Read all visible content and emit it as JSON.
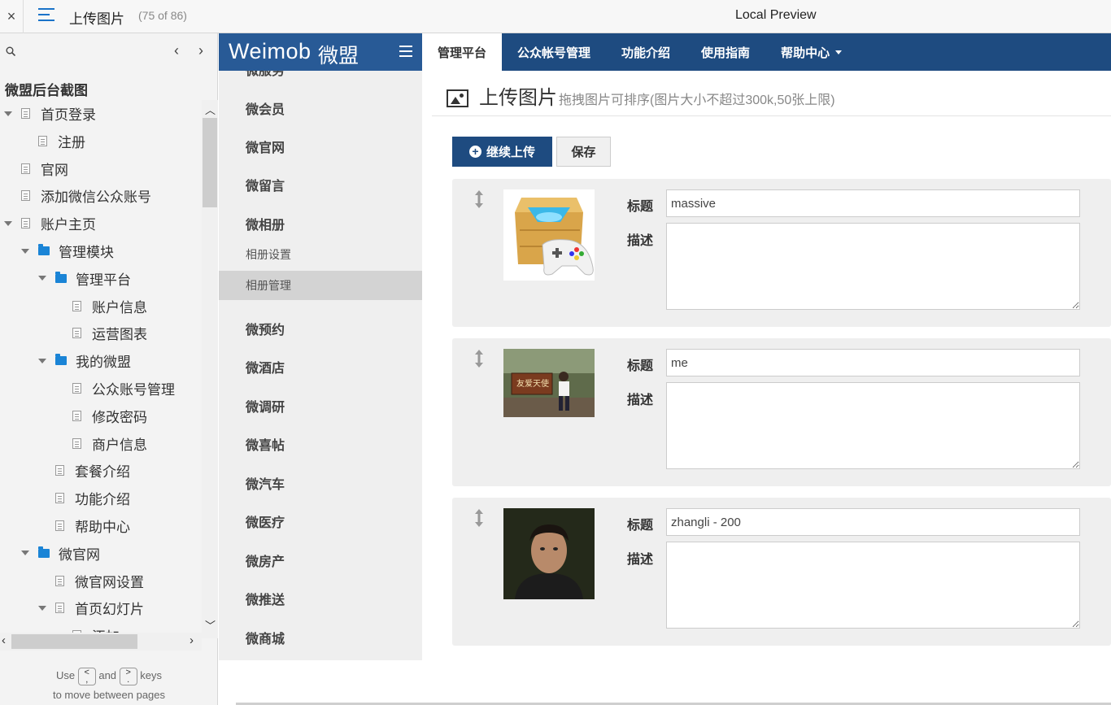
{
  "topbar": {
    "close": "×",
    "title": "上传图片",
    "count": "(75 of 86)",
    "preview": "Local Preview"
  },
  "tree": {
    "heading": "微盟后台截图",
    "prev": "‹",
    "next": "›",
    "items": [
      {
        "label": "首页登录",
        "type": "page",
        "expand": true
      },
      {
        "label": "注册",
        "type": "page",
        "expand": false
      },
      {
        "label": "官网",
        "type": "page",
        "expand": false
      },
      {
        "label": "添加微信公众账号",
        "type": "page",
        "expand": false
      },
      {
        "label": "账户主页",
        "type": "page",
        "expand": true
      },
      {
        "label": "管理模块",
        "type": "folder",
        "expand": true
      },
      {
        "label": "管理平台",
        "type": "folder",
        "expand": true
      },
      {
        "label": "账户信息",
        "type": "page",
        "expand": false
      },
      {
        "label": "运营图表",
        "type": "page",
        "expand": false
      },
      {
        "label": "我的微盟",
        "type": "folder",
        "expand": true
      },
      {
        "label": "公众账号管理",
        "type": "page",
        "expand": false
      },
      {
        "label": "修改密码",
        "type": "page",
        "expand": false
      },
      {
        "label": "商户信息",
        "type": "page",
        "expand": false
      },
      {
        "label": "套餐介绍",
        "type": "page",
        "expand": false
      },
      {
        "label": "功能介绍",
        "type": "page",
        "expand": false
      },
      {
        "label": "帮助中心",
        "type": "page",
        "expand": false
      },
      {
        "label": "微官网",
        "type": "folder",
        "expand": true
      },
      {
        "label": "微官网设置",
        "type": "page",
        "expand": false
      },
      {
        "label": "首页幻灯片",
        "type": "page",
        "expand": true
      },
      {
        "label": "添加",
        "type": "page",
        "expand": false
      }
    ],
    "keys_use": "Use",
    "keys_and": "and",
    "keys_keys": "keys",
    "keys_line2": "to move between pages",
    "key_prev": "<\n,",
    "key_next": ">\n."
  },
  "app": {
    "logo": "Weimob",
    "logo_cn": "微盟",
    "nav": [
      "管理平台",
      "公众帐号管理",
      "功能介绍",
      "使用指南",
      "帮助中心"
    ],
    "menu": [
      {
        "label": "微服务",
        "sub": false,
        "sel": false
      },
      {
        "label": "微会员",
        "sub": false,
        "sel": false
      },
      {
        "label": "微官网",
        "sub": false,
        "sel": false
      },
      {
        "label": "微留言",
        "sub": false,
        "sel": false
      },
      {
        "label": "微相册",
        "sub": false,
        "sel": false
      },
      {
        "label": "相册设置",
        "sub": true,
        "sel": false
      },
      {
        "label": "相册管理",
        "sub": true,
        "sel": true
      },
      {
        "label": "微预约",
        "sub": false,
        "sel": false
      },
      {
        "label": "微酒店",
        "sub": false,
        "sel": false
      },
      {
        "label": "微调研",
        "sub": false,
        "sel": false
      },
      {
        "label": "微喜帖",
        "sub": false,
        "sel": false
      },
      {
        "label": "微汽车",
        "sub": false,
        "sel": false
      },
      {
        "label": "微医疗",
        "sub": false,
        "sel": false
      },
      {
        "label": "微房产",
        "sub": false,
        "sel": false
      },
      {
        "label": "微推送",
        "sub": false,
        "sel": false
      },
      {
        "label": "微商城",
        "sub": false,
        "sel": false
      }
    ]
  },
  "main": {
    "title": "上传图片",
    "hint": "拖拽图片可排序(图片大小不超过300k,50张上限)",
    "upload_label": "继续上传",
    "save_label": "保存",
    "title_label": "标题",
    "desc_label": "描述",
    "images": [
      {
        "title": "massive",
        "desc": "",
        "thumb": "game-box"
      },
      {
        "title": "me",
        "desc": "",
        "thumb": "person-sign"
      },
      {
        "title": "zhangli - 200",
        "desc": "",
        "thumb": "portrait"
      }
    ]
  }
}
